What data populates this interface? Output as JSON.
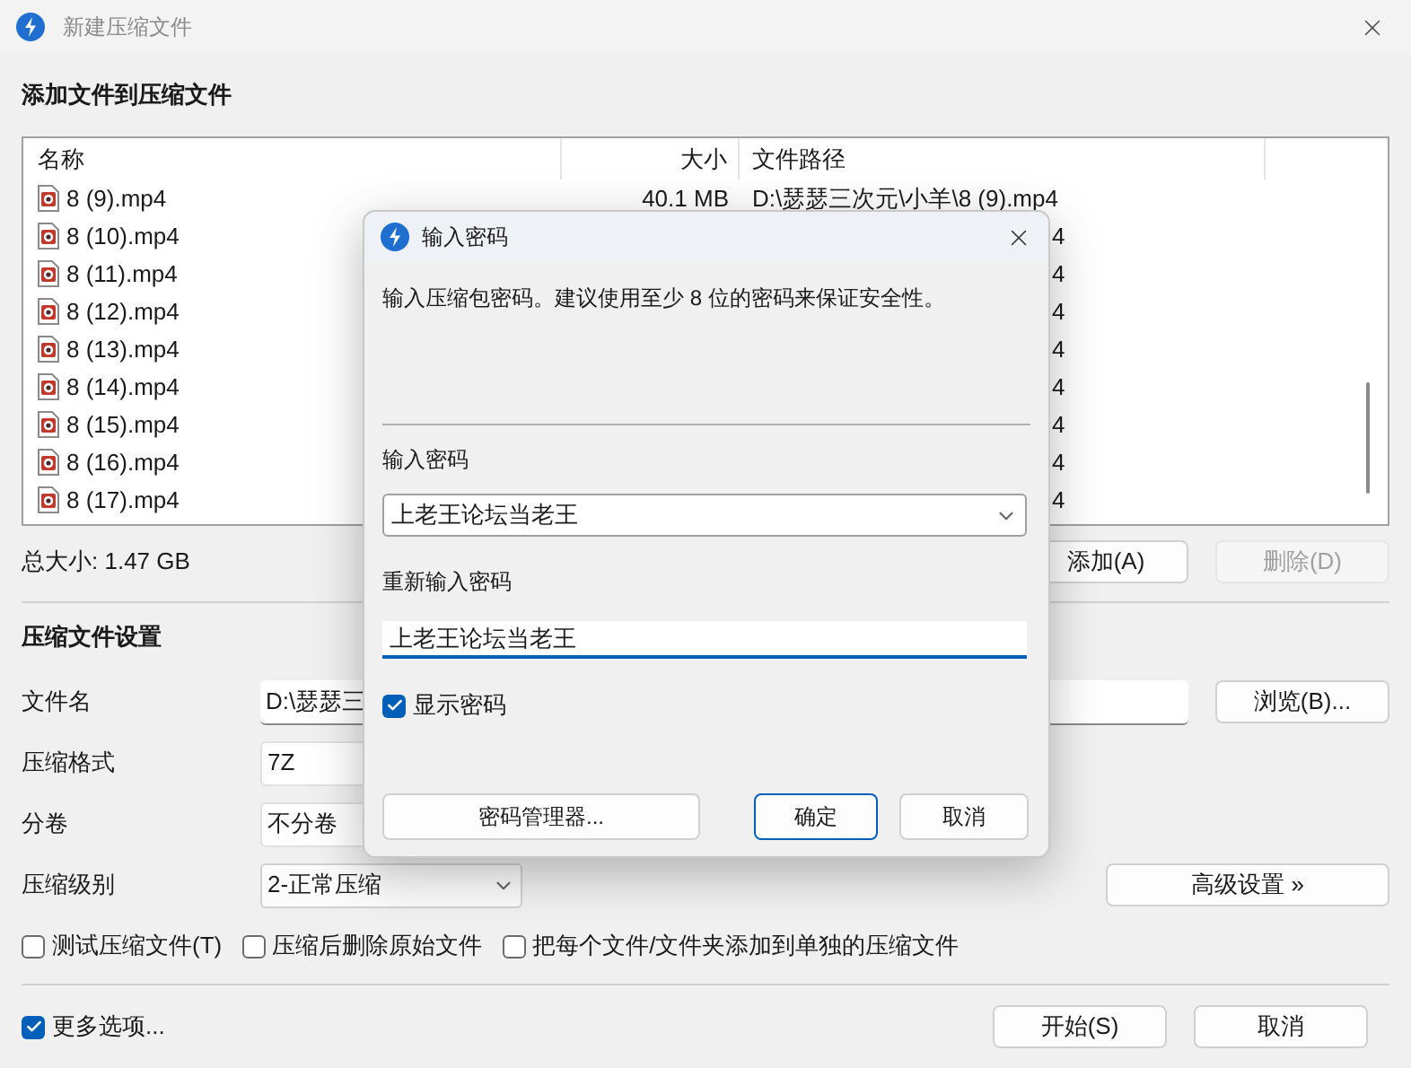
{
  "window": {
    "title": "新建压缩文件"
  },
  "files": {
    "title": "添加文件到压缩文件",
    "columns": [
      "名称",
      "大小",
      "文件路径"
    ],
    "rows": [
      {
        "kind": "full",
        "name": "8 (9).mp4",
        "size": "40.1 MB",
        "path": "D:\\瑟瑟三次元\\小羊\\8 (9).mp4"
      },
      {
        "kind": "covered",
        "name": "8 (10).mp4",
        "path": "4"
      },
      {
        "kind": "covered",
        "name": "8 (11).mp4",
        "path": "4"
      },
      {
        "kind": "covered",
        "name": "8 (12).mp4",
        "path": "4"
      },
      {
        "kind": "covered",
        "name": "8 (13).mp4",
        "path": "4"
      },
      {
        "kind": "covered",
        "name": "8 (14).mp4",
        "path": "4"
      },
      {
        "kind": "covered",
        "name": "8 (15).mp4",
        "path": "4"
      },
      {
        "kind": "covered",
        "name": "8 (16).mp4",
        "path": "4"
      },
      {
        "kind": "covered",
        "name": "8 (17).mp4",
        "path": "4"
      }
    ]
  },
  "total_size": "总大小: 1.47 GB",
  "list_buttons": [
    {
      "label": "添加(A)",
      "disabled": false
    },
    {
      "label": "删除(D)",
      "disabled": true
    }
  ],
  "settings": {
    "title": "压缩文件设置",
    "fields": [
      {
        "kind": "text",
        "label": "文件名",
        "value": "D:\\瑟瑟三",
        "button": "浏览(B)..."
      },
      {
        "kind": "covered-combo",
        "label": "压缩格式",
        "value": "7Z"
      },
      {
        "kind": "covered-combo",
        "label": "分卷",
        "value": "不分卷"
      },
      {
        "kind": "combo",
        "label": "压缩级别",
        "value": "2-正常压缩",
        "button": "高级设置 »"
      }
    ]
  },
  "options": [
    {
      "label": "测试压缩文件(T)",
      "checked": false
    },
    {
      "label": "压缩后删除原始文件",
      "checked": false
    },
    {
      "label": "把每个文件/文件夹添加到单独的压缩文件",
      "checked": false
    }
  ],
  "more_options": {
    "label": "更多选项...",
    "checked": true
  },
  "buttons": [
    "开始(S)",
    "取消"
  ],
  "dialog": {
    "title": "输入密码",
    "description": "输入压缩包密码。建议使用至少 8 位的密码来保证安全性。",
    "password_label": "输入密码",
    "password": "上老王论坛当老王",
    "confirm_label": "重新输入密码",
    "confirm": "上老王论坛当老王",
    "show_password": {
      "label": "显示密码",
      "checked": true
    },
    "buttons": [
      {
        "label": "密码管理器...",
        "default": false
      },
      {
        "label": "确定",
        "default": true
      },
      {
        "label": "取消",
        "default": false
      }
    ]
  }
}
